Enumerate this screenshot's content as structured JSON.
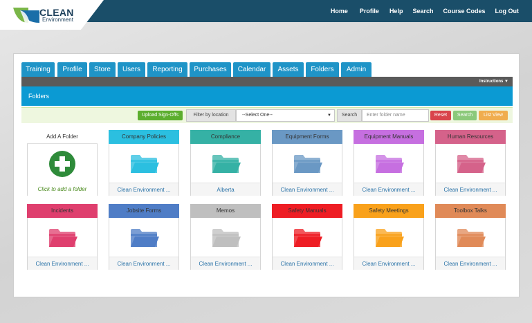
{
  "brand": {
    "title": "CLEAN",
    "subtitle": "Environment"
  },
  "topnav": [
    "Home",
    "Profile",
    "Help",
    "Search",
    "Course Codes",
    "Log Out"
  ],
  "tabs": [
    "Training",
    "Profile",
    "Store",
    "Users",
    "Reporting",
    "Purchases",
    "Calendar",
    "Assets",
    "Folders",
    "Admin"
  ],
  "instructions_label": "Instructions",
  "section_title": "Folders",
  "filter": {
    "upload_label": "Upload Sign-Offs",
    "location_label": "Filter by location",
    "location_value": "--Select One--",
    "search_label": "Search",
    "search_placeholder": "Enter folder name",
    "reset_label": "Reset",
    "search_button": "Search",
    "list_view_label": "List View"
  },
  "add_folder": {
    "title": "Add A Folder",
    "hint": "Click to add a folder"
  },
  "folders": [
    {
      "name": "Company Policies",
      "footer": "Clean Environment ...",
      "color": "#2bbfe0"
    },
    {
      "name": "Compliance",
      "footer": "Alberta",
      "color": "#35b1a5"
    },
    {
      "name": "Equipment Forms",
      "footer": "Clean Environment ...",
      "color": "#6a98c4"
    },
    {
      "name": "Equipment Manuals",
      "footer": "Clean Environment ...",
      "color": "#c66fe0"
    },
    {
      "name": "Human Resources",
      "footer": "Clean Environment ...",
      "color": "#d5628a"
    },
    {
      "name": "Incidents",
      "footer": "Clean Environment ...",
      "color": "#df3f6e"
    },
    {
      "name": "Jobsite Forms",
      "footer": "Clean Environment ...",
      "color": "#4f7dc6"
    },
    {
      "name": "Memos",
      "footer": "Clean Environment ...",
      "color": "#bfbfbf"
    },
    {
      "name": "Safety Manuals",
      "footer": "Clean Environment ...",
      "color": "#ee1d24"
    },
    {
      "name": "Safety Meetings",
      "footer": "Clean Environment ...",
      "color": "#f9a11b"
    },
    {
      "name": "Toolbox Talks",
      "footer": "Clean Environment ...",
      "color": "#e08a58"
    }
  ],
  "colors": {
    "topbar": "#1a4e69",
    "tab": "#1f94c7",
    "section_bar": "#0b9ad3",
    "upload": "#5cae2e",
    "reset": "#d9444b",
    "search_btn": "#8bc97a",
    "list_view": "#f0ad4e",
    "add_icon": "#2e8b3a"
  }
}
